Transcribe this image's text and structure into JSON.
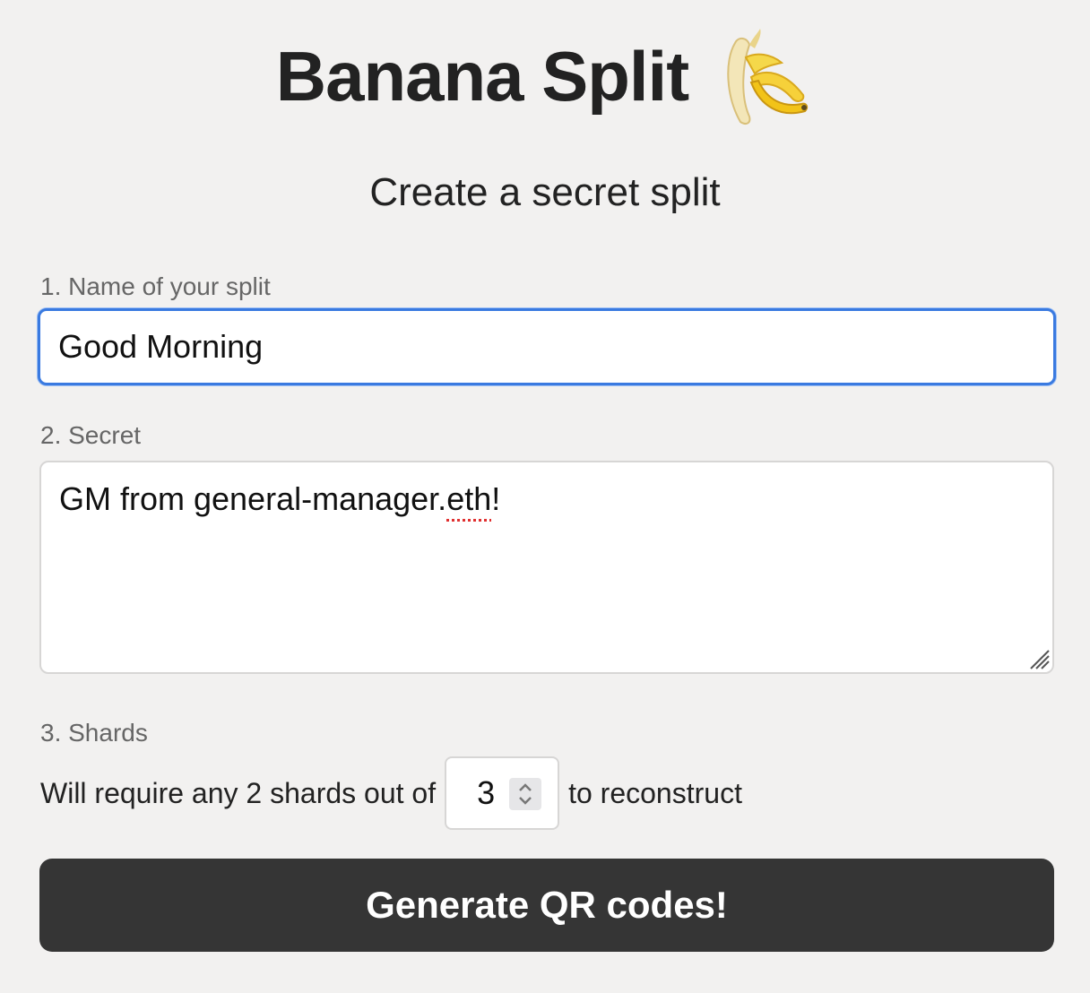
{
  "header": {
    "title": "Banana Split",
    "logo_icon": "banana-icon"
  },
  "subtitle": "Create a secret split",
  "form": {
    "name_label": "1. Name of your split",
    "name_value": "Good Morning",
    "secret_label": "2. Secret",
    "secret_value_prefix": "GM from general-manager.",
    "secret_value_misspelled": "eth",
    "secret_value_suffix": "!",
    "shards_label": "3. Shards",
    "shards_prefix": "Will require any 2 shards out of",
    "shards_total": "3",
    "shards_suffix": "to reconstruct",
    "generate_label": "Generate QR codes!"
  },
  "colors": {
    "background": "#f2f1f0",
    "focus_border": "#3a7ae0",
    "button_bg": "#353535",
    "spellcheck": "#e03030"
  }
}
